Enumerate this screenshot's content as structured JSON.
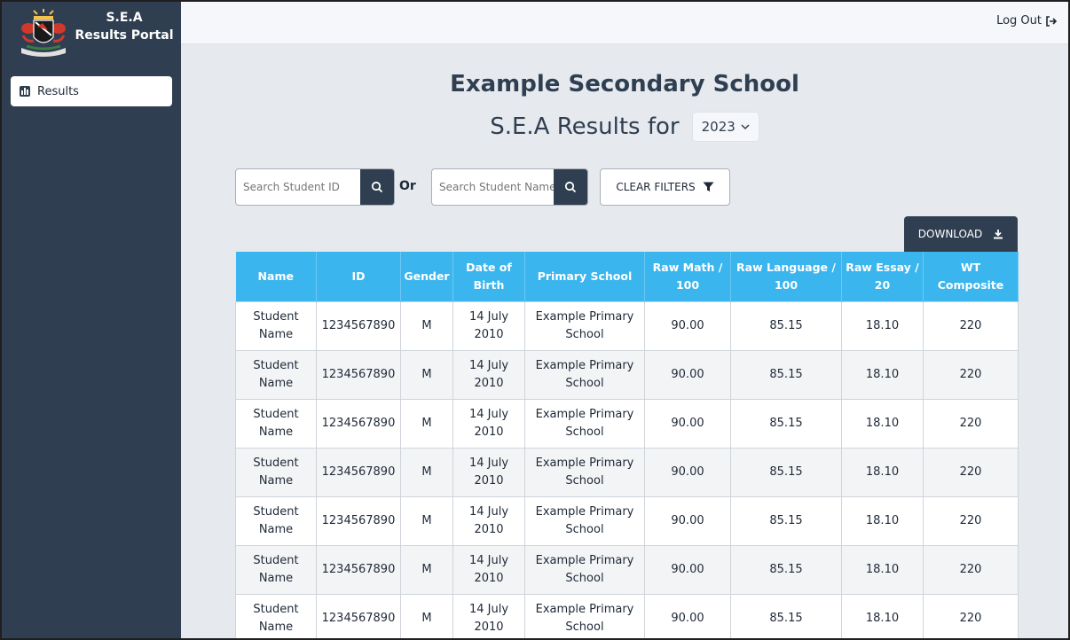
{
  "brand": {
    "line1": "S.E.A",
    "line2": "Results Portal"
  },
  "nav": [
    {
      "label": "Results",
      "icon": "bar-chart-icon"
    }
  ],
  "topbar": {
    "logout_label": "Log Out",
    "logout_icon": "sign-out-icon"
  },
  "main": {
    "school_name": "Example Secondary School",
    "results_for": "S.E.A Results for",
    "year": "2023"
  },
  "filters": {
    "student_id_placeholder": "Search Student ID",
    "or_label": "Or",
    "student_name_placeholder": "Search Student Name",
    "clear_label": "CLEAR FILTERS"
  },
  "download_label": "DOWNLOAD",
  "table": {
    "headers": [
      "Name",
      "ID",
      "Gender",
      "Date of Birth",
      "Primary School",
      "Raw Math / 100",
      "Raw Language / 100",
      "Raw Essay / 20",
      "WT Composite"
    ],
    "rows": [
      [
        "Student Name",
        "1234567890",
        "M",
        "14 July 2010",
        "Example Primary School",
        "90.00",
        "85.15",
        "18.10",
        "220"
      ],
      [
        "Student Name",
        "1234567890",
        "M",
        "14 July 2010",
        "Example Primary School",
        "90.00",
        "85.15",
        "18.10",
        "220"
      ],
      [
        "Student Name",
        "1234567890",
        "M",
        "14 July 2010",
        "Example Primary School",
        "90.00",
        "85.15",
        "18.10",
        "220"
      ],
      [
        "Student Name",
        "1234567890",
        "M",
        "14 July 2010",
        "Example Primary School",
        "90.00",
        "85.15",
        "18.10",
        "220"
      ],
      [
        "Student Name",
        "1234567890",
        "M",
        "14 July 2010",
        "Example Primary School",
        "90.00",
        "85.15",
        "18.10",
        "220"
      ],
      [
        "Student Name",
        "1234567890",
        "M",
        "14 July 2010",
        "Example Primary School",
        "90.00",
        "85.15",
        "18.10",
        "220"
      ],
      [
        "Student Name",
        "1234567890",
        "M",
        "14 July 2010",
        "Example Primary School",
        "90.00",
        "85.15",
        "18.10",
        "220"
      ]
    ]
  },
  "colors": {
    "sidebar": "#2f3e50",
    "header": "#3bb5ee",
    "background": "#e6e9ee"
  }
}
